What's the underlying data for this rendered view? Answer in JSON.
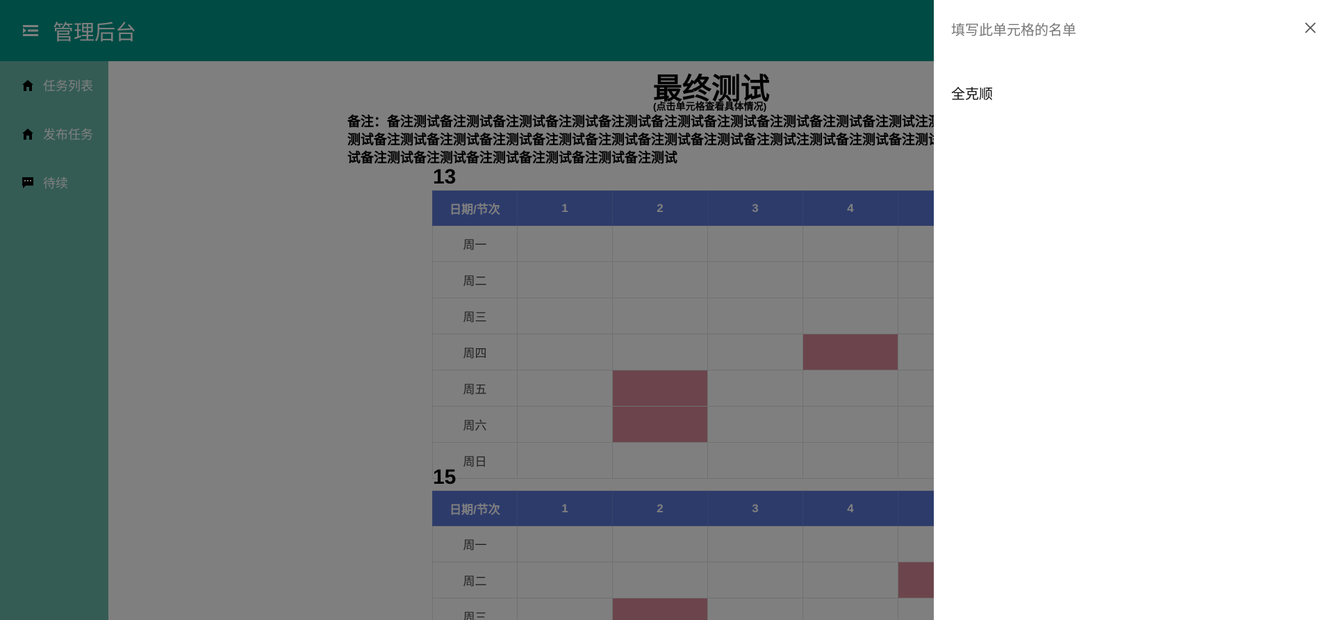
{
  "colors": {
    "header_bg": "#009688",
    "sidebar_bg": "#69b8aa",
    "th_bg": "#5a77d6",
    "fill_bg": "#d88a98"
  },
  "app": {
    "title": "管理后台"
  },
  "sidebar": {
    "items": [
      {
        "icon": "home-icon",
        "label": "任务列表"
      },
      {
        "icon": "home-icon",
        "label": "发布任务"
      },
      {
        "icon": "chat-icon",
        "label": "待续"
      }
    ]
  },
  "page": {
    "title": "最终测试",
    "subtitle": "(点击单元格查看具体情况)",
    "remark": "备注：备注测试备注测试备注测试备注测试备注测试备注测试备注测试备注测试备注测试备注测试注测试备注测试备注测试备注测试备注测试备注测试备注测试备注测试备注测试备注测试备注测试注测试备注测试备注测试备注测试备注测试备注测试备注测试备注测试备注测试备注测试备注测试"
  },
  "schedules": [
    {
      "label": "13",
      "headers": [
        "日期/节次",
        "1",
        "2",
        "3",
        "4",
        ""
      ],
      "rows": [
        {
          "day": "周一",
          "filled": [
            false,
            false,
            false,
            false,
            false
          ]
        },
        {
          "day": "周二",
          "filled": [
            false,
            false,
            false,
            false,
            false
          ]
        },
        {
          "day": "周三",
          "filled": [
            false,
            false,
            false,
            false,
            false
          ]
        },
        {
          "day": "周四",
          "filled": [
            false,
            false,
            false,
            true,
            false
          ]
        },
        {
          "day": "周五",
          "filled": [
            false,
            true,
            false,
            false,
            false
          ]
        },
        {
          "day": "周六",
          "filled": [
            false,
            true,
            false,
            false,
            false
          ]
        },
        {
          "day": "周日",
          "filled": [
            false,
            false,
            false,
            false,
            false
          ]
        }
      ]
    },
    {
      "label": "15",
      "headers": [
        "日期/节次",
        "1",
        "2",
        "3",
        "4",
        ""
      ],
      "rows": [
        {
          "day": "周一",
          "filled": [
            false,
            false,
            false,
            false,
            false
          ]
        },
        {
          "day": "周二",
          "filled": [
            false,
            false,
            false,
            false,
            true
          ]
        },
        {
          "day": "周三",
          "filled": [
            false,
            true,
            false,
            false,
            false
          ]
        }
      ]
    }
  ],
  "drawer": {
    "title": "填写此单元格的名单",
    "names": [
      "全克顺"
    ]
  }
}
